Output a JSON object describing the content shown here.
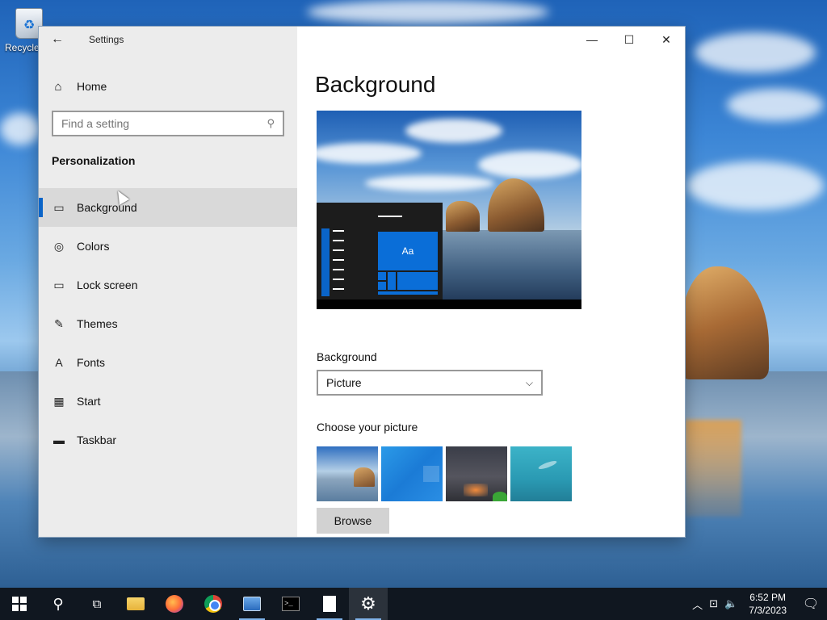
{
  "desktop": {
    "recycle_bin_label": "Recycle"
  },
  "window": {
    "title": "Settings",
    "back_icon": "back-arrow-icon",
    "controls": {
      "minimize": "—",
      "maximize": "☐",
      "close": "✕"
    }
  },
  "sidebar": {
    "home_label": "Home",
    "search_placeholder": "Find a setting",
    "section_title": "Personalization",
    "items": [
      {
        "label": "Background",
        "icon": "picture-icon",
        "active": true
      },
      {
        "label": "Colors",
        "icon": "palette-icon",
        "active": false
      },
      {
        "label": "Lock screen",
        "icon": "lock-screen-icon",
        "active": false
      },
      {
        "label": "Themes",
        "icon": "themes-icon",
        "active": false
      },
      {
        "label": "Fonts",
        "icon": "fonts-icon",
        "active": false
      },
      {
        "label": "Start",
        "icon": "start-icon",
        "active": false
      },
      {
        "label": "Taskbar",
        "icon": "taskbar-icon",
        "active": false
      }
    ]
  },
  "main": {
    "title": "Background",
    "preview_tile_text": "Aa",
    "background_label": "Background",
    "background_value": "Picture",
    "choose_label": "Choose your picture",
    "browse_label": "Browse"
  },
  "taskbar": {
    "time": "6:52 PM",
    "date": "7/3/2023",
    "accent": "#0a64c8"
  }
}
